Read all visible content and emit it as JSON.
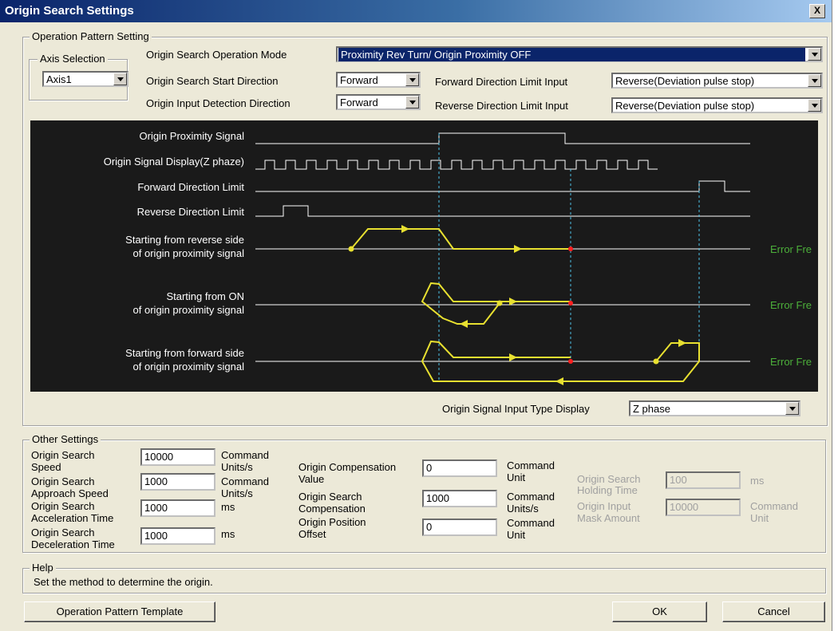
{
  "window": {
    "title": "Origin Search Settings",
    "close": "X"
  },
  "operation_pattern": {
    "legend": "Operation Pattern Setting",
    "axis_selection": {
      "label": "Axis Selection",
      "value": "Axis1"
    },
    "mode": {
      "label": "Origin Search Operation Mode",
      "value": "Proximity Rev Turn/ Origin Proximity OFF"
    },
    "start_direction": {
      "label": "Origin Search Start Direction",
      "value": "Forward"
    },
    "input_detection": {
      "label": "Origin Input Detection Direction",
      "value": "Forward"
    },
    "fwd_limit": {
      "label": "Forward Direction Limit Input",
      "value": "Reverse(Deviation pulse stop)"
    },
    "rev_limit": {
      "label": "Reverse Direction Limit Input",
      "value": "Reverse(Deviation pulse stop)"
    },
    "diagram": {
      "signals": [
        "Origin Proximity Signal",
        "Origin Signal Display(Z phaze)",
        "Forward Direction Limit",
        "Reverse Direction Limit"
      ],
      "cases": [
        {
          "line1": "Starting from reverse side",
          "line2": "of origin proximity signal",
          "status": "Error Fre"
        },
        {
          "line1": "Starting from ON",
          "line2": "of origin proximity signal",
          "status": "Error Fre"
        },
        {
          "line1": "Starting from forward side",
          "line2": "of origin proximity signal",
          "status": "Error Fre"
        }
      ],
      "colors": {
        "background": "#1a1a1a",
        "path": "#e8e030",
        "marker": "#ff2020",
        "guide": "#4fc3e8",
        "status": "#4caf3a"
      }
    },
    "signal_type": {
      "label": "Origin Signal Input Type Display",
      "value": "Z phase"
    }
  },
  "other_settings": {
    "legend": "Other Settings",
    "search_speed": {
      "label1": "Origin Search",
      "label2": "Speed",
      "value": "10000",
      "unit1": "Command",
      "unit2": "Units/s"
    },
    "approach_speed": {
      "label1": "Origin Search",
      "label2": "Approach Speed",
      "value": "1000",
      "unit1": "Command",
      "unit2": "Units/s"
    },
    "accel_time": {
      "label1": "Origin Search",
      "label2": "Acceleration Time",
      "value": "1000",
      "unit": "ms"
    },
    "decel_time": {
      "label1": "Origin Search",
      "label2": "Deceleration Time",
      "value": "1000",
      "unit": "ms"
    },
    "comp_value": {
      "label1": "Origin Compensation",
      "label2": "Value",
      "value": "0",
      "unit1": "Command",
      "unit2": "Unit"
    },
    "comp_speed": {
      "label1": "Origin Search",
      "label2": "Compensation",
      "value": "1000",
      "unit1": "Command",
      "unit2": "Units/s"
    },
    "position_offset": {
      "label1": "Origin Position",
      "label2": "Offset",
      "value": "0",
      "unit1": "Command",
      "unit2": "Unit"
    },
    "holding_time": {
      "label1": "Origin Search",
      "label2": "Holding Time",
      "value": "100",
      "unit": "ms"
    },
    "mask_amount": {
      "label1": "Origin Input",
      "label2": "Mask Amount",
      "value": "10000",
      "unit1": "Command",
      "unit2": "Unit"
    }
  },
  "help": {
    "legend": "Help",
    "text": "Set the method to determine the origin."
  },
  "buttons": {
    "template": "Operation Pattern Template",
    "ok": "OK",
    "cancel": "Cancel"
  }
}
